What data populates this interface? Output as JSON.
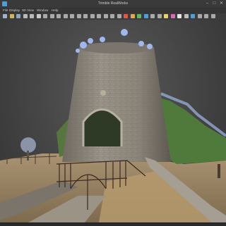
{
  "app": {
    "title": "Trimble RealWorks"
  },
  "window_controls": {
    "minimize": "–",
    "maximize": "□",
    "close": "✕"
  },
  "menu": [
    "File",
    "Display",
    "3D View",
    "Window",
    "Help"
  ],
  "toolbar_icons": [
    {
      "name": "new-icon",
      "color": "#9fb4c9"
    },
    {
      "name": "open-icon",
      "color": "#d2b35a"
    },
    {
      "name": "save-icon",
      "color": "#8fa6c2"
    },
    {
      "name": "undo-icon",
      "color": "#b9b9b9"
    },
    {
      "name": "redo-icon",
      "color": "#b9b9b9"
    },
    {
      "name": "select-icon",
      "color": "#c9c9c9"
    },
    {
      "name": "pan-icon",
      "color": "#a9a9a9"
    },
    {
      "name": "zoom-icon",
      "color": "#a9a9a9"
    },
    {
      "name": "rotate-icon",
      "color": "#a9a9a9"
    },
    {
      "name": "fit-icon",
      "color": "#a9a9a9"
    },
    {
      "name": "front-view-icon",
      "color": "#a9a9a9"
    },
    {
      "name": "top-view-icon",
      "color": "#a9a9a9"
    },
    {
      "name": "side-view-icon",
      "color": "#a9a9a9"
    },
    {
      "name": "measure-icon",
      "color": "#a9a9a9"
    },
    {
      "name": "section-icon",
      "color": "#a9a9a9"
    },
    {
      "name": "segment-icon",
      "color": "#a9a9a9"
    },
    {
      "name": "point-size-icon",
      "color": "#a9a9a9"
    },
    {
      "name": "render-icon",
      "color": "#a9a9a9"
    },
    {
      "name": "color-mode-icon",
      "color": "#e2554b"
    },
    {
      "name": "intensity-icon",
      "color": "#e0a94a"
    },
    {
      "name": "rgb-icon",
      "color": "#5fb85f"
    },
    {
      "name": "elevation-icon",
      "color": "#4aa0d8"
    },
    {
      "name": "layers-icon",
      "color": "#a9a9a9"
    },
    {
      "name": "grid-icon",
      "color": "#a9a9a9"
    },
    {
      "name": "camera-icon",
      "color": "#e7d36a"
    },
    {
      "name": "image-icon",
      "color": "#d86ab8"
    },
    {
      "name": "light-icon",
      "color": "#e8e8e8"
    },
    {
      "name": "settings-icon",
      "color": "#bdbdbd"
    },
    {
      "name": "help-icon",
      "color": "#4aa0d8"
    },
    {
      "name": "tools-icon",
      "color": "#a9a9a9"
    },
    {
      "name": "filter-icon",
      "color": "#a9a9a9"
    },
    {
      "name": "export-icon",
      "color": "#a9a9a9"
    }
  ],
  "viewport": {
    "content": "point-cloud-windmill-tower"
  },
  "colors": {
    "accent": "#4aa0d8",
    "background": "#3a3a3a"
  }
}
